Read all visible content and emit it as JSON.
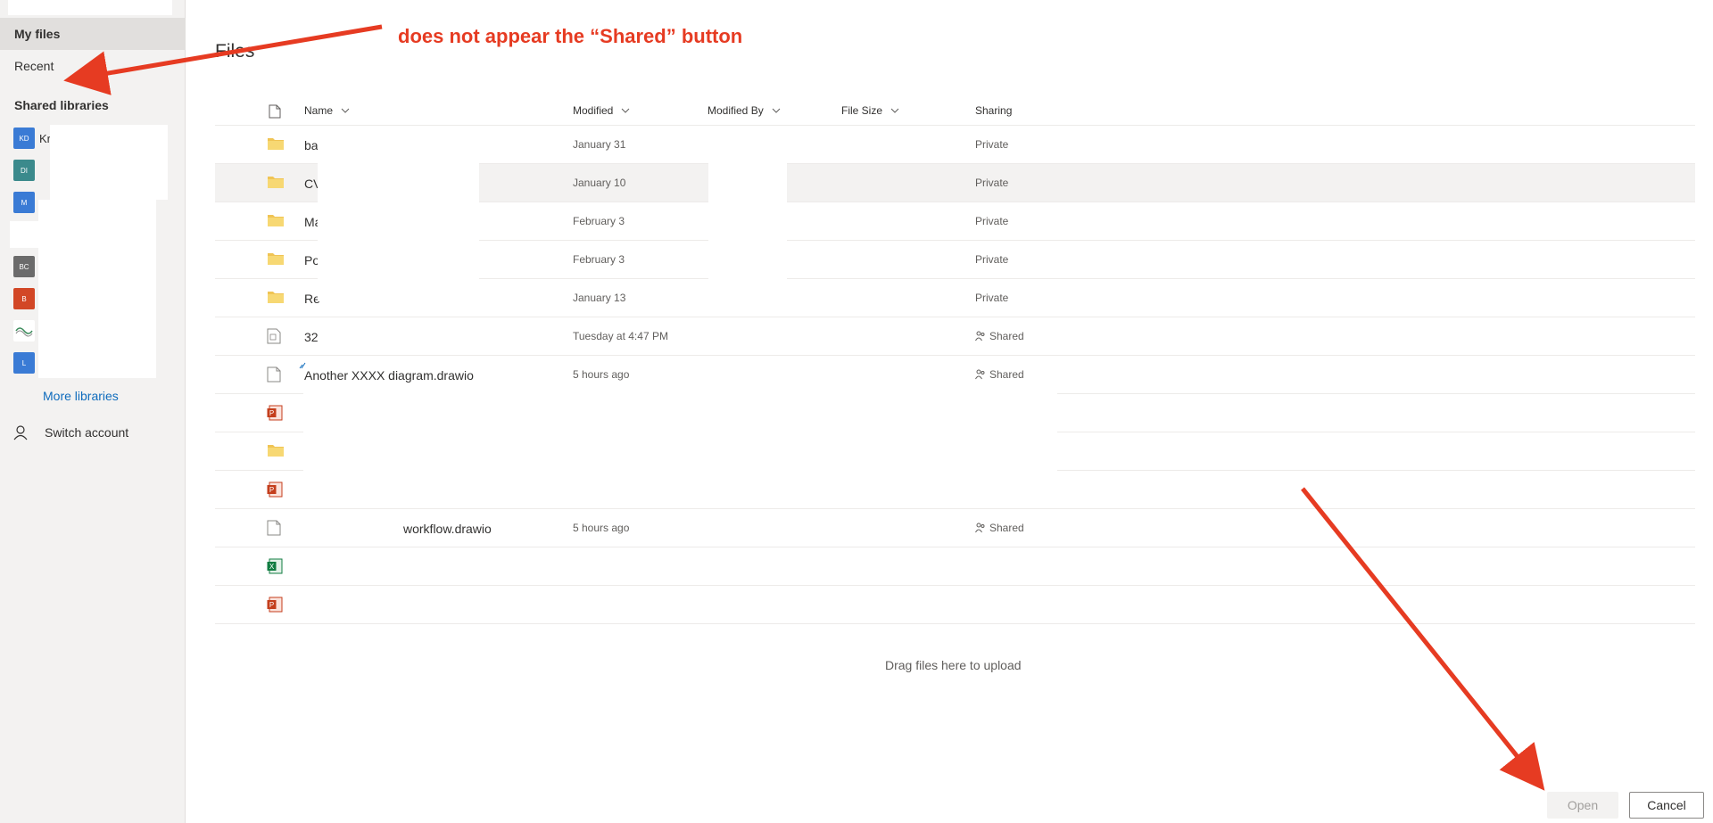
{
  "sidebar": {
    "my_files": "My files",
    "recent": "Recent",
    "shared_libraries_heading": "Shared libraries",
    "libraries": [
      {
        "initials": "KD",
        "name": "Kr",
        "color": "#3a7bd5"
      },
      {
        "initials": "DI",
        "name": "",
        "color": "#3b8a8c"
      },
      {
        "initials": "M",
        "name": "",
        "color": "#3a7bd5"
      },
      {
        "initials": "BC",
        "name": "",
        "color": "#6b6b6b"
      },
      {
        "initials": "B",
        "name": "",
        "color": "#d24726"
      },
      {
        "initials": "",
        "name": "",
        "color": "#ffffff"
      },
      {
        "initials": "L",
        "name": "",
        "color": "#3a7bd5"
      }
    ],
    "more_libraries": "More libraries",
    "switch_account": "Switch account"
  },
  "main": {
    "title": "Files",
    "annotation": "does not appear the “Shared” button",
    "columns": {
      "name": "Name",
      "modified": "Modified",
      "modified_by": "Modified By",
      "file_size": "File Size",
      "sharing": "Sharing"
    },
    "rows": [
      {
        "icon": "folder-icon",
        "name": "ba",
        "modified": "January 31",
        "sharing": "Private"
      },
      {
        "icon": "folder-icon",
        "name": "CV",
        "modified": "January 10",
        "sharing": "Private"
      },
      {
        "icon": "folder-icon",
        "name": "Ma",
        "modified": "February 3",
        "sharing": "Private"
      },
      {
        "icon": "folder-icon",
        "name": "Po",
        "modified": "February 3",
        "sharing": "Private"
      },
      {
        "icon": "folder-icon",
        "name": "Re",
        "modified": "January 13",
        "sharing": "Private"
      },
      {
        "icon": "document-icon",
        "name": "32",
        "modified": "Tuesday at 4:47 PM",
        "sharing": "Shared"
      },
      {
        "icon": "file-icon",
        "name": "Another XXXX diagram.drawio",
        "modified": "5 hours ago",
        "sharing": "Shared"
      },
      {
        "icon": "powerpoint-icon",
        "name": "",
        "modified": "",
        "sharing": ""
      },
      {
        "icon": "folder-icon",
        "name": "",
        "modified": "",
        "sharing": ""
      },
      {
        "icon": "powerpoint-icon",
        "name": "",
        "modified": "",
        "sharing": ""
      },
      {
        "icon": "file-icon",
        "name": "workflow.drawio",
        "modified": "5 hours ago",
        "sharing": "Shared"
      },
      {
        "icon": "excel-icon",
        "name": "",
        "modified": "",
        "sharing": ""
      },
      {
        "icon": "powerpoint-icon",
        "name": "",
        "modified": "",
        "sharing": ""
      }
    ],
    "drop_hint": "Drag files here to upload"
  },
  "footer": {
    "open_label": "Open",
    "cancel_label": "Cancel"
  },
  "colors": {
    "annotation": "#e63b22",
    "link": "#0f6cbd",
    "folder": "#f0c454",
    "powerpoint": "#c43e1c",
    "excel": "#107c41"
  }
}
